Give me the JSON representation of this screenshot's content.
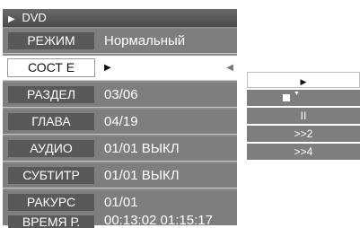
{
  "header": {
    "title": "DVD",
    "icon": "play-icon"
  },
  "rows": [
    {
      "label": "РЕЖИМ",
      "value": "Нормальный"
    },
    {
      "label": "СОСТ Е",
      "value": ""
    },
    {
      "label": "РАЗДЕЛ",
      "value": "03/06"
    },
    {
      "label": "ГЛАВА",
      "value": "04/19"
    },
    {
      "label": "АУДИО",
      "value": "01/01  ВЫКЛ"
    },
    {
      "label": "СУБТИТР",
      "value": "01/01  ВЫКЛ"
    },
    {
      "label": "РАКУРС",
      "value": "01/01"
    },
    {
      "label": "ВРЕМЯ Р.",
      "value": "00:13:02  01:15:17"
    }
  ],
  "options": [
    {
      "label": "",
      "icon": "play-icon"
    },
    {
      "label": "",
      "icon": "stop-icon"
    },
    {
      "label": "II",
      "icon": "pause-icon"
    },
    {
      "label": ">>2",
      "icon": ""
    },
    {
      "label": ">>4",
      "icon": ""
    }
  ],
  "colors": {
    "panel": "#7e7e7e",
    "header": "#505050",
    "label_bg": "#595959",
    "selected": "#ffffff"
  }
}
